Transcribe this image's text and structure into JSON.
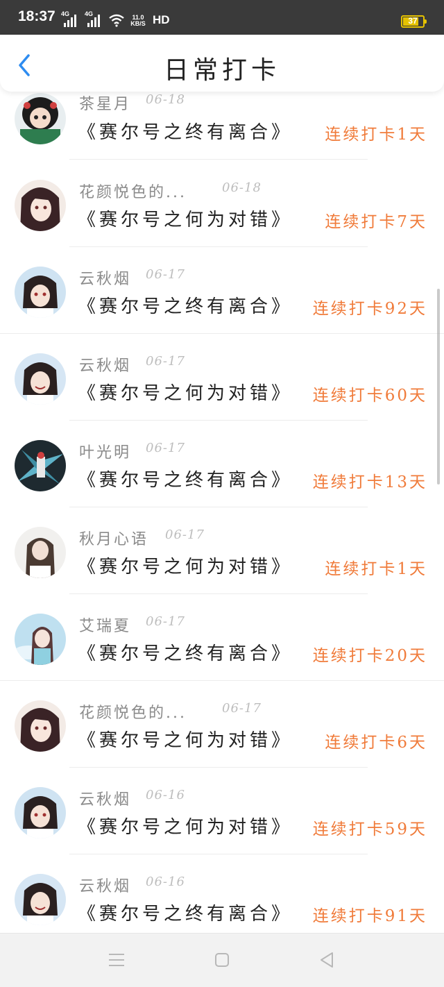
{
  "status_bar": {
    "time": "18:37",
    "network_label_1": "4G",
    "network_label_2": "4G",
    "speed_value": "11.0",
    "speed_unit": "KB/S",
    "hd_label": "HD",
    "battery_level": "37",
    "battery_color": "#e6c200"
  },
  "header": {
    "title": "日常打卡",
    "back_icon": "chevron-left-icon",
    "accent_color": "#2d8cf0"
  },
  "checkins": [
    {
      "user": "茶星月",
      "date": "06-18",
      "book": "《赛尔号之终有离合》",
      "streak": "连续打卡1天"
    },
    {
      "user": "花颜悦色的...",
      "date": "06-18",
      "book": "《赛尔号之何为对错》",
      "streak": "连续打卡7天"
    },
    {
      "user": "云秋烟",
      "date": "06-17",
      "book": "《赛尔号之终有离合》",
      "streak": "连续打卡92天"
    },
    {
      "user": "云秋烟",
      "date": "06-17",
      "book": "《赛尔号之何为对错》",
      "streak": "连续打卡60天"
    },
    {
      "user": "叶光明",
      "date": "06-17",
      "book": "《赛尔号之终有离合》",
      "streak": "连续打卡13天"
    },
    {
      "user": "秋月心语",
      "date": "06-17",
      "book": "《赛尔号之何为对错》",
      "streak": "连续打卡1天"
    },
    {
      "user": "艾瑞夏",
      "date": "06-17",
      "book": "《赛尔号之终有离合》",
      "streak": "连续打卡20天"
    },
    {
      "user": "花颜悦色的...",
      "date": "06-17",
      "book": "《赛尔号之何为对错》",
      "streak": "连续打卡6天"
    },
    {
      "user": "云秋烟",
      "date": "06-16",
      "book": "《赛尔号之何为对错》",
      "streak": "连续打卡59天"
    },
    {
      "user": "云秋烟",
      "date": "06-16",
      "book": "《赛尔号之终有离合》",
      "streak": "连续打卡91天"
    }
  ],
  "colors": {
    "streak": "#f07b3a",
    "username": "#8a8a8a",
    "date": "#bdbdbd"
  },
  "navbar": {
    "menu_icon": "menu-icon",
    "home_icon": "home-square-icon",
    "back_icon": "back-triangle-icon"
  }
}
